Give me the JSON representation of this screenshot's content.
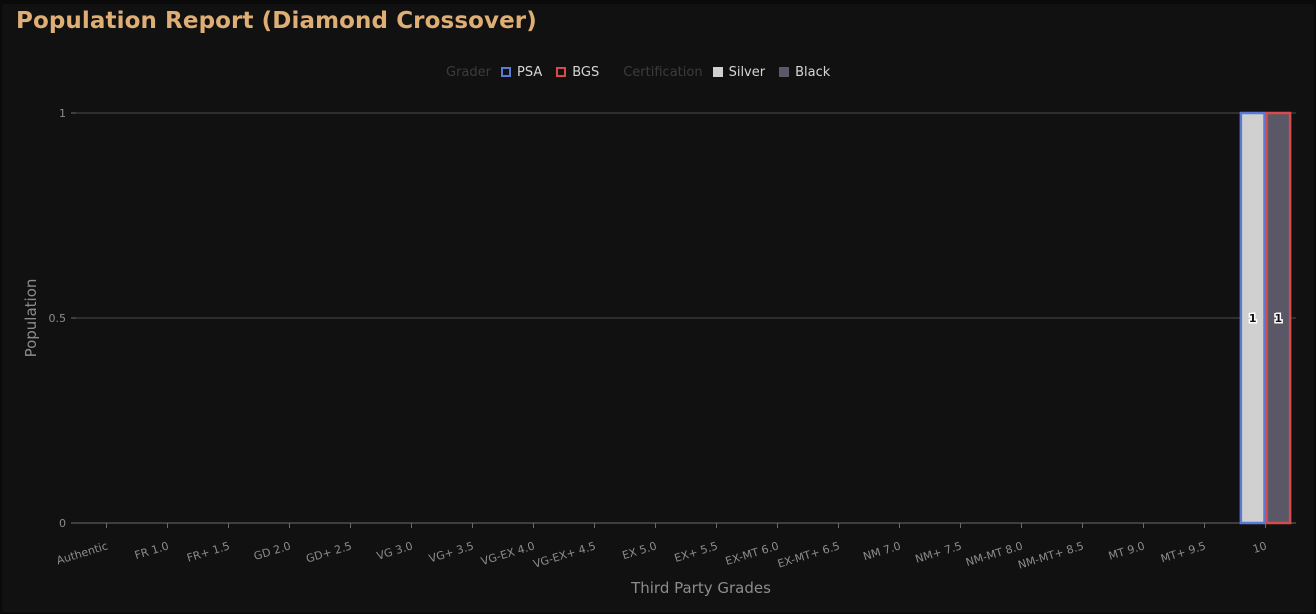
{
  "title": "Population Report (Diamond Crossover)",
  "legend": {
    "grader_title": "Grader",
    "graders": [
      {
        "label": "PSA",
        "color": "#5b7ad6"
      },
      {
        "label": "BGS",
        "color": "#d64b4b"
      }
    ],
    "certification_title": "Certification",
    "certifications": [
      {
        "label": "Silver",
        "color": "#d0d0d0"
      },
      {
        "label": "Black",
        "color": "#5a5766"
      }
    ]
  },
  "chart_data": {
    "type": "bar",
    "title": "Population Report (Diamond Crossover)",
    "xlabel": "Third Party Grades",
    "ylabel": "Population",
    "ylim": [
      0,
      1
    ],
    "yticks": [
      0,
      0.5,
      1
    ],
    "grid": true,
    "legend_position": "top-center",
    "categories": [
      "Authentic",
      "FR 1.0",
      "FR+ 1.5",
      "GD 2.0",
      "GD+ 2.5",
      "VG 3.0",
      "VG+ 3.5",
      "VG-EX 4.0",
      "VG-EX+ 4.5",
      "EX 5.0",
      "EX+ 5.5",
      "EX-MT 6.0",
      "EX-MT+ 6.5",
      "NM 7.0",
      "NM+ 7.5",
      "NM-MT 8.0",
      "NM-MT+ 8.5",
      "MT 9.0",
      "MT+ 9.5",
      "10"
    ],
    "series": [
      {
        "name": "PSA",
        "certification": "Silver",
        "fill": "#d0d0d0",
        "stroke": "#5b7ad6",
        "values": [
          0,
          0,
          0,
          0,
          0,
          0,
          0,
          0,
          0,
          0,
          0,
          0,
          0,
          0,
          0,
          0,
          0,
          0,
          0,
          1
        ]
      },
      {
        "name": "BGS",
        "certification": "Black",
        "fill": "#5a5766",
        "stroke": "#d64b4b",
        "values": [
          0,
          0,
          0,
          0,
          0,
          0,
          0,
          0,
          0,
          0,
          0,
          0,
          0,
          0,
          0,
          0,
          0,
          0,
          0,
          1
        ]
      }
    ]
  }
}
